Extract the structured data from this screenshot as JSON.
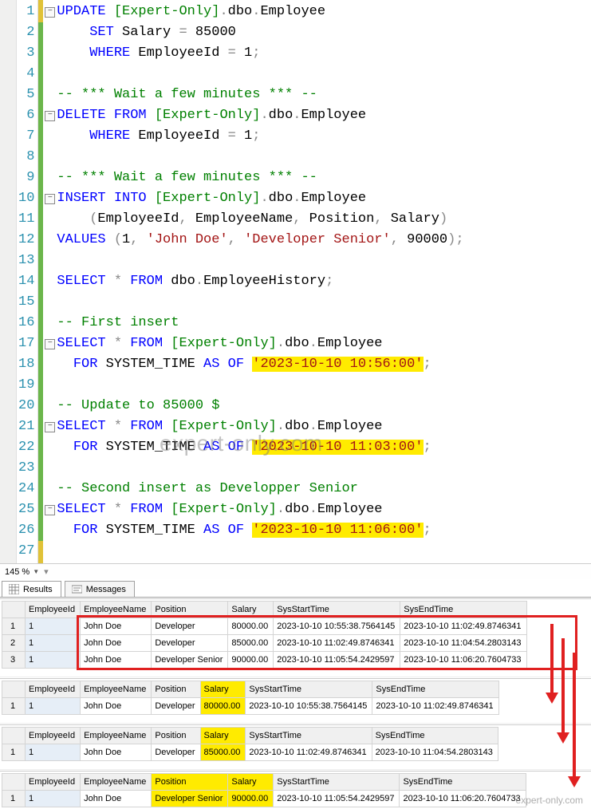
{
  "editor": {
    "lines": [
      {
        "n": 1,
        "fold": true,
        "segs": [
          [
            "UPDATE",
            "kw-blue"
          ],
          [
            " [Expert-Only]",
            "kw-green"
          ],
          [
            ".",
            "op"
          ],
          [
            "dbo",
            "punct"
          ],
          [
            ".",
            "op"
          ],
          [
            "Employee",
            "punct"
          ]
        ]
      },
      {
        "n": 2,
        "fold": false,
        "segs": [
          [
            "    ",
            "punct"
          ],
          [
            "SET",
            "kw-blue"
          ],
          [
            " Salary ",
            "punct"
          ],
          [
            "=",
            "op"
          ],
          [
            " 85000",
            "punct"
          ]
        ]
      },
      {
        "n": 3,
        "fold": false,
        "segs": [
          [
            "    ",
            "punct"
          ],
          [
            "WHERE",
            "kw-blue"
          ],
          [
            " EmployeeId ",
            "punct"
          ],
          [
            "=",
            "op"
          ],
          [
            " 1",
            "punct"
          ],
          [
            ";",
            "op"
          ]
        ]
      },
      {
        "n": 4,
        "fold": false,
        "segs": []
      },
      {
        "n": 5,
        "fold": false,
        "segs": [
          [
            "-- *** Wait a few minutes *** --",
            "comment"
          ]
        ]
      },
      {
        "n": 6,
        "fold": true,
        "segs": [
          [
            "DELETE",
            "kw-blue"
          ],
          [
            " ",
            "punct"
          ],
          [
            "FROM",
            "kw-blue"
          ],
          [
            " [Expert-Only]",
            "kw-green"
          ],
          [
            ".",
            "op"
          ],
          [
            "dbo",
            "punct"
          ],
          [
            ".",
            "op"
          ],
          [
            "Employee",
            "punct"
          ]
        ]
      },
      {
        "n": 7,
        "fold": false,
        "segs": [
          [
            "    ",
            "punct"
          ],
          [
            "WHERE",
            "kw-blue"
          ],
          [
            " EmployeeId ",
            "punct"
          ],
          [
            "=",
            "op"
          ],
          [
            " 1",
            "punct"
          ],
          [
            ";",
            "op"
          ]
        ]
      },
      {
        "n": 8,
        "fold": false,
        "segs": []
      },
      {
        "n": 9,
        "fold": false,
        "segs": [
          [
            "-- *** Wait a few minutes *** --",
            "comment"
          ]
        ]
      },
      {
        "n": 10,
        "fold": true,
        "segs": [
          [
            "INSERT",
            "kw-blue"
          ],
          [
            " ",
            "punct"
          ],
          [
            "INTO",
            "kw-blue"
          ],
          [
            " [Expert-Only]",
            "kw-green"
          ],
          [
            ".",
            "op"
          ],
          [
            "dbo",
            "punct"
          ],
          [
            ".",
            "op"
          ],
          [
            "Employee",
            "punct"
          ]
        ]
      },
      {
        "n": 11,
        "fold": false,
        "segs": [
          [
            "    ",
            "punct"
          ],
          [
            "(",
            "op"
          ],
          [
            "EmployeeId",
            "punct"
          ],
          [
            ",",
            "op"
          ],
          [
            " EmployeeName",
            "punct"
          ],
          [
            ",",
            "op"
          ],
          [
            " Position",
            "punct"
          ],
          [
            ",",
            "op"
          ],
          [
            " Salary",
            "punct"
          ],
          [
            ")",
            "op"
          ]
        ]
      },
      {
        "n": 12,
        "fold": false,
        "segs": [
          [
            "VALUES",
            "kw-blue"
          ],
          [
            " ",
            "punct"
          ],
          [
            "(",
            "op"
          ],
          [
            "1",
            "punct"
          ],
          [
            ",",
            "op"
          ],
          [
            " ",
            "punct"
          ],
          [
            "'John Doe'",
            "kw-red"
          ],
          [
            ",",
            "op"
          ],
          [
            " ",
            "punct"
          ],
          [
            "'Developer Senior'",
            "kw-red"
          ],
          [
            ",",
            "op"
          ],
          [
            " 90000",
            "punct"
          ],
          [
            ")",
            "op"
          ],
          [
            ";",
            "op"
          ]
        ]
      },
      {
        "n": 13,
        "fold": false,
        "segs": []
      },
      {
        "n": 14,
        "fold": false,
        "segs": [
          [
            "SELECT",
            "kw-blue"
          ],
          [
            " ",
            "punct"
          ],
          [
            "*",
            "op"
          ],
          [
            " ",
            "punct"
          ],
          [
            "FROM",
            "kw-blue"
          ],
          [
            " dbo",
            "punct"
          ],
          [
            ".",
            "op"
          ],
          [
            "EmployeeHistory",
            "punct"
          ],
          [
            ";",
            "op"
          ]
        ]
      },
      {
        "n": 15,
        "fold": false,
        "segs": []
      },
      {
        "n": 16,
        "fold": false,
        "segs": [
          [
            "-- First insert",
            "comment"
          ]
        ]
      },
      {
        "n": 17,
        "fold": true,
        "segs": [
          [
            "SELECT",
            "kw-blue"
          ],
          [
            " ",
            "punct"
          ],
          [
            "*",
            "op"
          ],
          [
            " ",
            "punct"
          ],
          [
            "FROM",
            "kw-blue"
          ],
          [
            " [Expert-Only]",
            "kw-green"
          ],
          [
            ".",
            "op"
          ],
          [
            "dbo",
            "punct"
          ],
          [
            ".",
            "op"
          ],
          [
            "Employee",
            "punct"
          ]
        ]
      },
      {
        "n": 18,
        "fold": false,
        "segs": [
          [
            "  ",
            "punct"
          ],
          [
            "FOR",
            "kw-blue"
          ],
          [
            " SYSTEM_TIME ",
            "punct"
          ],
          [
            "AS",
            "kw-blue"
          ],
          [
            " ",
            "punct"
          ],
          [
            "OF",
            "kw-blue"
          ],
          [
            " ",
            "punct"
          ],
          [
            "'2023-10-10 10:56:00'",
            "kw-red hl"
          ],
          [
            ";",
            "op"
          ]
        ]
      },
      {
        "n": 19,
        "fold": false,
        "segs": []
      },
      {
        "n": 20,
        "fold": false,
        "segs": [
          [
            "-- Update to 85000 $",
            "comment"
          ]
        ]
      },
      {
        "n": 21,
        "fold": true,
        "segs": [
          [
            "SELECT",
            "kw-blue"
          ],
          [
            " ",
            "punct"
          ],
          [
            "*",
            "op"
          ],
          [
            " ",
            "punct"
          ],
          [
            "FROM",
            "kw-blue"
          ],
          [
            " [Expert-Only]",
            "kw-green"
          ],
          [
            ".",
            "op"
          ],
          [
            "dbo",
            "punct"
          ],
          [
            ".",
            "op"
          ],
          [
            "Employee",
            "punct"
          ]
        ]
      },
      {
        "n": 22,
        "fold": false,
        "segs": [
          [
            "  ",
            "punct"
          ],
          [
            "FOR",
            "kw-blue"
          ],
          [
            " SYSTEM_TIME ",
            "punct"
          ],
          [
            "AS",
            "kw-blue"
          ],
          [
            " ",
            "punct"
          ],
          [
            "OF",
            "kw-blue"
          ],
          [
            " ",
            "punct"
          ],
          [
            "'2023-10-10 11:03:00'",
            "kw-red hl"
          ],
          [
            ";",
            "op"
          ]
        ]
      },
      {
        "n": 23,
        "fold": false,
        "segs": []
      },
      {
        "n": 24,
        "fold": false,
        "segs": [
          [
            "-- Second insert as Developper Senior",
            "comment"
          ]
        ]
      },
      {
        "n": 25,
        "fold": true,
        "segs": [
          [
            "SELECT",
            "kw-blue"
          ],
          [
            " ",
            "punct"
          ],
          [
            "*",
            "op"
          ],
          [
            " ",
            "punct"
          ],
          [
            "FROM",
            "kw-blue"
          ],
          [
            " [Expert-Only]",
            "kw-green"
          ],
          [
            ".",
            "op"
          ],
          [
            "dbo",
            "punct"
          ],
          [
            ".",
            "op"
          ],
          [
            "Employee",
            "punct"
          ]
        ]
      },
      {
        "n": 26,
        "fold": false,
        "segs": [
          [
            "  ",
            "punct"
          ],
          [
            "FOR",
            "kw-blue"
          ],
          [
            " SYSTEM_TIME ",
            "punct"
          ],
          [
            "AS",
            "kw-blue"
          ],
          [
            " ",
            "punct"
          ],
          [
            "OF",
            "kw-blue"
          ],
          [
            " ",
            "punct"
          ],
          [
            "'2023-10-10 11:06:00'",
            "kw-red hl"
          ],
          [
            ";",
            "op"
          ]
        ]
      },
      {
        "n": 27,
        "fold": false,
        "segs": []
      }
    ]
  },
  "zoom": "145 %",
  "tabs": {
    "results": "Results",
    "messages": "Messages"
  },
  "headers": [
    "",
    "EmployeeId",
    "EmployeeName",
    "Position",
    "Salary",
    "SysStartTime",
    "SysEndTime"
  ],
  "grid1": {
    "rows": [
      [
        "1",
        "1",
        "John Doe",
        "Developer",
        "80000.00",
        "2023-10-10 10:55:38.7564145",
        "2023-10-10 11:02:49.8746341"
      ],
      [
        "2",
        "1",
        "John Doe",
        "Developer",
        "85000.00",
        "2023-10-10 11:02:49.8746341",
        "2023-10-10 11:04:54.2803143"
      ],
      [
        "3",
        "1",
        "John Doe",
        "Developer Senior",
        "90000.00",
        "2023-10-10 11:05:54.2429597",
        "2023-10-10 11:06:20.7604733"
      ]
    ]
  },
  "grid2": {
    "rows": [
      [
        "1",
        "1",
        "John Doe",
        "Developer",
        "80000.00",
        "2023-10-10 10:55:38.7564145",
        "2023-10-10 11:02:49.8746341"
      ]
    ],
    "hl_headers": [
      4
    ],
    "hl_cells": [
      [
        0,
        4
      ]
    ]
  },
  "grid3": {
    "rows": [
      [
        "1",
        "1",
        "John Doe",
        "Developer",
        "85000.00",
        "2023-10-10 11:02:49.8746341",
        "2023-10-10 11:04:54.2803143"
      ]
    ],
    "hl_headers": [
      4
    ],
    "hl_cells": [
      [
        0,
        4
      ]
    ]
  },
  "grid4": {
    "rows": [
      [
        "1",
        "1",
        "John Doe",
        "Developer Senior",
        "90000.00",
        "2023-10-10 11:05:54.2429597",
        "2023-10-10 11:06:20.7604733"
      ]
    ],
    "hl_headers": [
      3,
      4
    ],
    "hl_cells": [
      [
        0,
        3
      ],
      [
        0,
        4
      ]
    ]
  },
  "watermark": "expert-only.com"
}
